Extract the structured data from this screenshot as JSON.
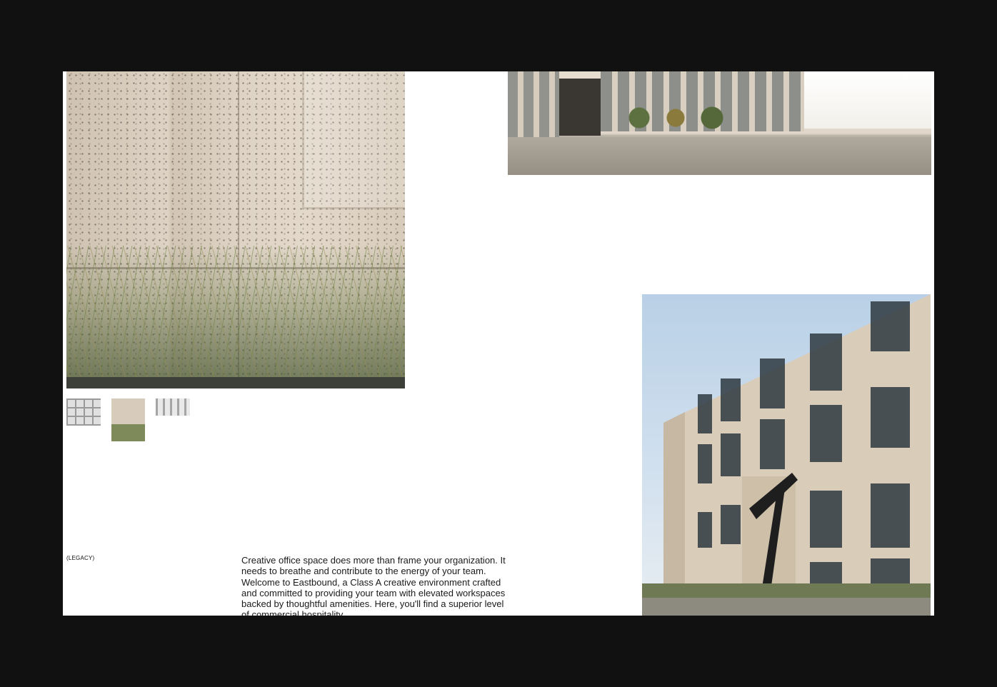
{
  "section_label": "(LEGACY)",
  "intro_text": "Creative office space does more than frame your organization. It needs to breathe and contribute to the energy of your team. Welcome to Eastbound, a Class A creative environment crafted and committed to providing your team with elevated workspaces backed by thoughtful amenities. Here, you'll find a superior level of commercial hospitality",
  "gallery": {
    "active_thumbnail": 2,
    "thumbnails": [
      "building-grid-thumbnail",
      "terrazzo-grass-thumbnail",
      "facade-thumbnail"
    ]
  },
  "colors": {
    "frame_background": "#111111",
    "page_background": "#ffffff",
    "text": "#1a1a1a"
  }
}
